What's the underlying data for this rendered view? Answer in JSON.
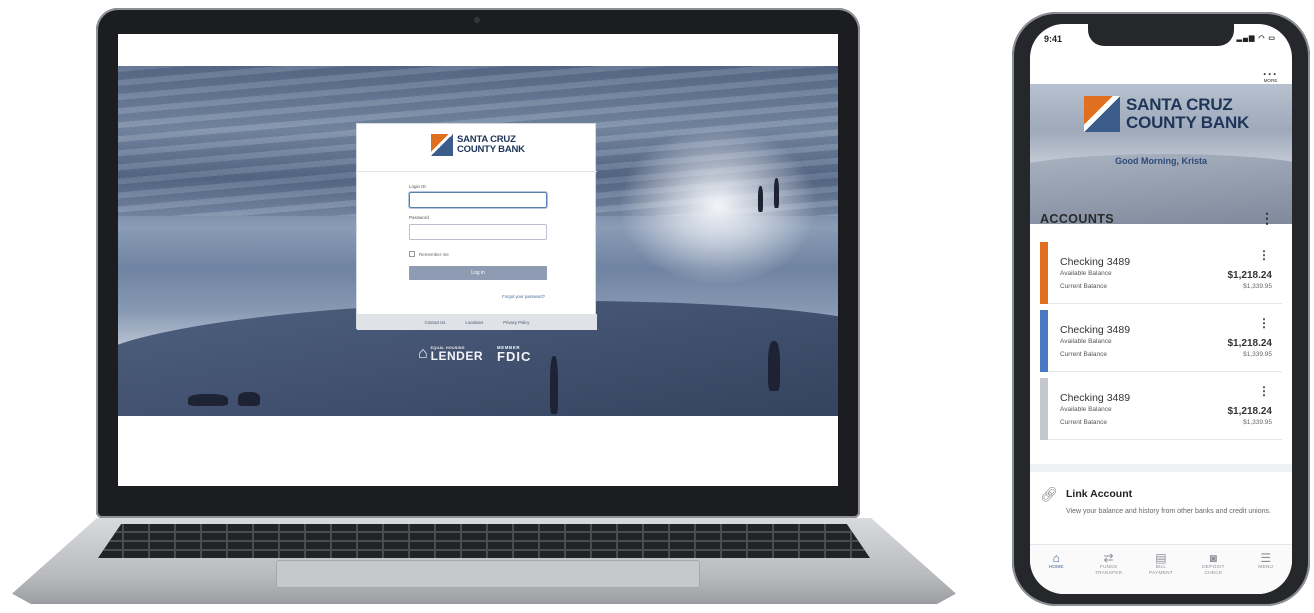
{
  "brand": {
    "line1": "SANTA CRUZ",
    "line2": "COUNTY BANK",
    "navy": "#1e3458",
    "orange": "#e0701f",
    "blue": "#3c5c8c"
  },
  "laptop": {
    "login": {
      "login_id_label": "Login ID",
      "password_label": "Password",
      "remember_label": "Remember me",
      "login_button": "Log in",
      "forgot_link": "Forgot your password?",
      "footer_links": [
        "Contact Us",
        "Locations",
        "Privacy Policy"
      ]
    },
    "badges": {
      "ehl_small": "EQUAL HOUSING",
      "ehl_big": "LENDER",
      "fdic_small": "MEMBER",
      "fdic_big": "FDIC"
    }
  },
  "phone": {
    "status_time": "9:41",
    "status_icons": "signal-wifi-battery",
    "more_label": "MORE",
    "greeting": "Good Morning, Krista",
    "accounts_heading": "ACCOUNTS",
    "accounts": [
      {
        "name": "Checking 3489",
        "available_label": "Available Balance",
        "current_label": "Current Balance",
        "available": "$1,218.24",
        "current": "$1,339.95",
        "color": "#e0701f"
      },
      {
        "name": "Checking 3489",
        "available_label": "Available Balance",
        "current_label": "Current Balance",
        "available": "$1,218.24",
        "current": "$1,339.95",
        "color": "#4a78c2"
      },
      {
        "name": "Checking 3489",
        "available_label": "Available Balance",
        "current_label": "Current Balance",
        "available": "$1,218.24",
        "current": "$1,339.95",
        "color": "#c4c7cc"
      }
    ],
    "link_account": {
      "title": "Link Account",
      "description": "View your balance and history from other banks and credit unions."
    },
    "tabs": [
      {
        "label": "HOME",
        "icon": "home-icon"
      },
      {
        "label": "FUNDS\nTRANSFER",
        "icon": "transfer-icon"
      },
      {
        "label": "BILL\nPAYMENT",
        "icon": "bill-icon"
      },
      {
        "label": "DEPOSIT\nCHECK",
        "icon": "camera-icon"
      },
      {
        "label": "MENU",
        "icon": "menu-icon"
      }
    ]
  }
}
